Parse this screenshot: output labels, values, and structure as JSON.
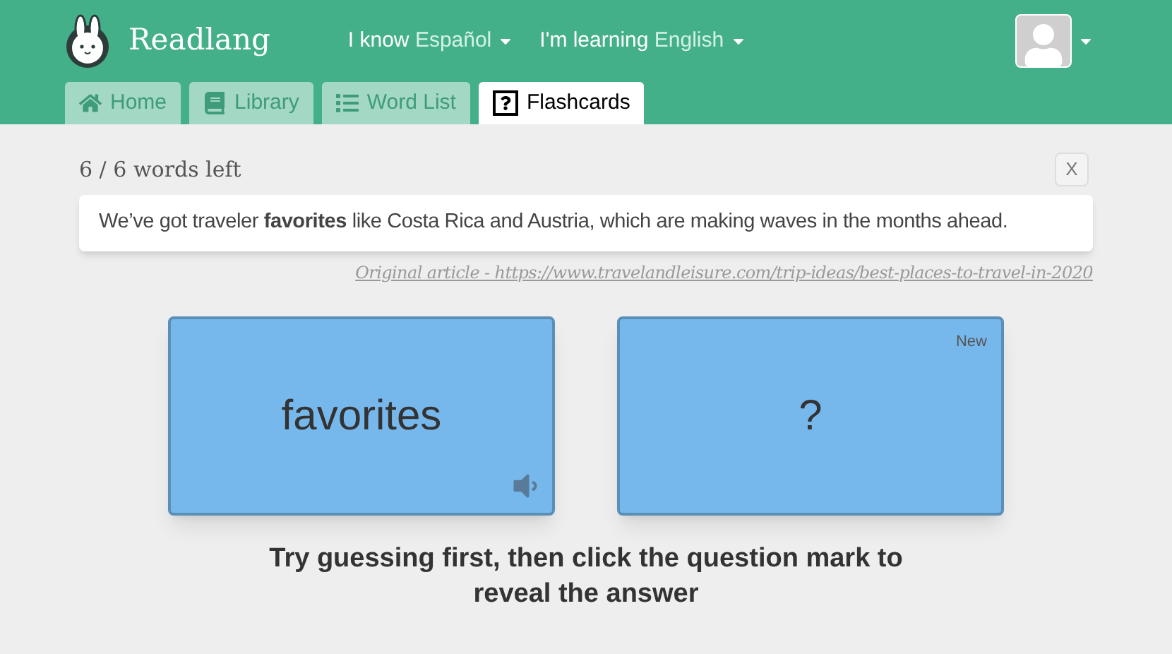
{
  "brand": "Readlang",
  "languages": [
    {
      "prefix": "I know",
      "value": "Español"
    },
    {
      "prefix": "I'm learning",
      "value": "English"
    }
  ],
  "tabs": [
    {
      "label": "Home",
      "kind": "home",
      "selected": false
    },
    {
      "label": "Library",
      "kind": "library",
      "selected": false
    },
    {
      "label": "Word List",
      "kind": "list",
      "selected": false
    },
    {
      "label": "Flashcards",
      "kind": "flashcards",
      "selected": true
    }
  ],
  "progress": "6 / 6 words left",
  "close": "X",
  "sentence": "We’ve got traveler **favorites** like Costa Rica and Austria, which are making waves in the months ahead.",
  "source_link": "Original article - https://www.travelandleisure.com/trip-ideas/best-places-to-travel-in-2020",
  "cards": [
    {
      "kind": "front",
      "text": "favorites"
    },
    {
      "kind": "back",
      "text": "?",
      "badge": "New"
    }
  ],
  "hint": "Try guessing first, then click the question mark to reveal the answer"
}
